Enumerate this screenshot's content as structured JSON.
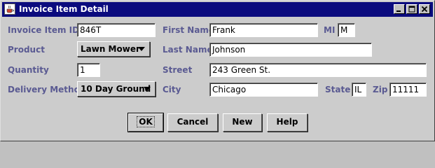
{
  "window": {
    "title": "Invoice Item Detail",
    "controls": {
      "minimize": "minimize",
      "maximize": "maximize",
      "close": "close"
    }
  },
  "labels": {
    "invoice_item_id": "Invoice Item ID",
    "product": "Product",
    "quantity": "Quantity",
    "delivery_method": "Delivery Method",
    "first_name": "First Name",
    "mi": "MI",
    "last_name": "Last Name",
    "street": "Street",
    "city": "City",
    "state": "State",
    "zip": "Zip"
  },
  "fields": {
    "invoice_item_id": "846T",
    "product": "Lawn Mower",
    "quantity": "1",
    "delivery_method": "10 Day Ground",
    "first_name": "Frank",
    "mi": "M",
    "last_name": "Johnson",
    "street": "243 Green St.",
    "city": "Chicago",
    "state": "IL",
    "zip": "11111"
  },
  "buttons": {
    "ok": "OK",
    "cancel": "Cancel",
    "new": "New",
    "help": "Help"
  },
  "colors": {
    "title_bar": "#0b0b7e",
    "label": "#5a5a92",
    "background": "#cccccc"
  }
}
